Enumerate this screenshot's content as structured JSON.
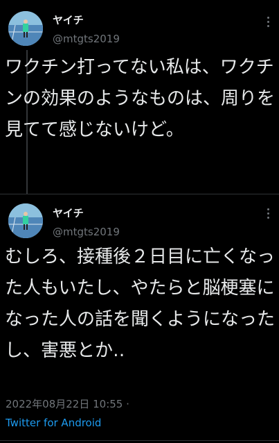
{
  "tweets": [
    {
      "display_name": "ヤイチ",
      "handle": "@mtgts2019",
      "text": "ワクチン打ってない私は、ワクチンの効果のようなものは、周りを見てて感じないけど。"
    },
    {
      "display_name": "ヤイチ",
      "handle": "@mtgts2019",
      "text": "むしろ、接種後２日目に亡くなった人もいたし、やたらと脳梗塞になった人の話を聞くようになったし、害悪とか‥",
      "timestamp": "2022年08月22日 10:55 ·",
      "source": "Twitter for Android"
    }
  ],
  "icons": {
    "avatar": "tennis-player-avatar",
    "more": "more-vertical-icon"
  },
  "colors": {
    "background": "#000000",
    "text": "#e7e9ea",
    "secondary": "#71767b",
    "link": "#1d9bf0"
  }
}
